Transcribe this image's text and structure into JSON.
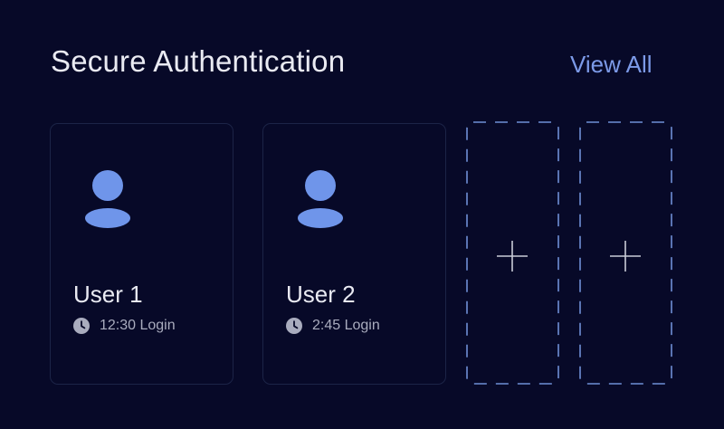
{
  "header": {
    "title": "Secure Authentication",
    "view_all_label": "View All"
  },
  "colors": {
    "background": "#070928",
    "accent": "#7c9ae8",
    "avatar": "#6f95ea",
    "card_border": "#1c2447",
    "text_primary": "#e9eaf2",
    "text_secondary": "#a9acbe"
  },
  "users": [
    {
      "name": "User 1",
      "login": "12:30 Login",
      "avatar_icon": "user-icon",
      "time_icon": "clock-icon"
    },
    {
      "name": "User 2",
      "login": "2:45 Login",
      "avatar_icon": "user-icon",
      "time_icon": "clock-icon"
    }
  ],
  "empty_slots": [
    {
      "icon": "plus-icon"
    },
    {
      "icon": "plus-icon"
    }
  ]
}
